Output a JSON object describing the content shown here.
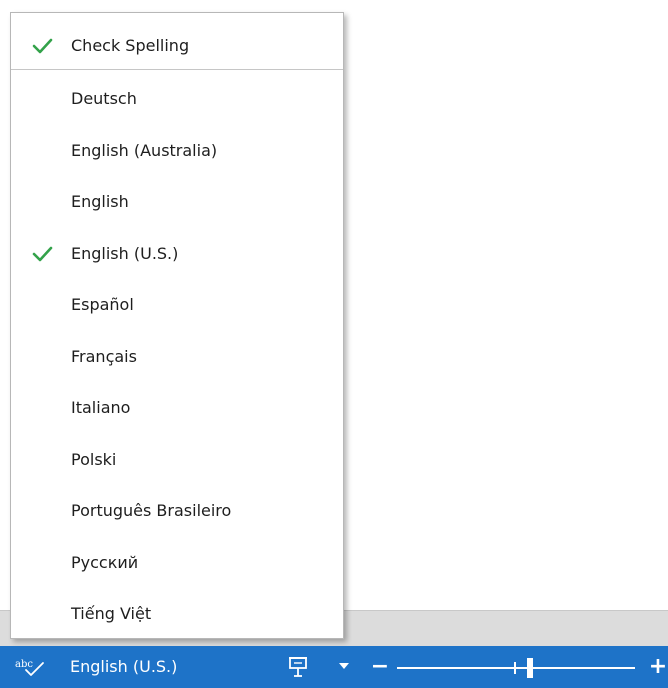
{
  "menu": {
    "check_spelling": {
      "label": "Check Spelling",
      "checked": true
    },
    "languages": [
      {
        "label": "Deutsch",
        "checked": false
      },
      {
        "label": "English (Australia)",
        "checked": false
      },
      {
        "label": "English",
        "checked": false
      },
      {
        "label": "English (U.S.)",
        "checked": true
      },
      {
        "label": "Español",
        "checked": false
      },
      {
        "label": "Français",
        "checked": false
      },
      {
        "label": "Italiano",
        "checked": false
      },
      {
        "label": "Polski",
        "checked": false
      },
      {
        "label": "Português Brasileiro",
        "checked": false
      },
      {
        "label": "Русский",
        "checked": false
      },
      {
        "label": "Tiếng Việt",
        "checked": false
      }
    ],
    "check_icon": "checkmark-icon"
  },
  "statusbar": {
    "spell_icon_text": "abc",
    "language_label": "English (U.S.)",
    "zoom_minus": "−",
    "zoom_plus": "+",
    "zoom_level_fraction": 0.55
  },
  "colors": {
    "status_bar": "#1e73c8",
    "check": "#33a24a",
    "menu_text": "#1e1e1e"
  }
}
